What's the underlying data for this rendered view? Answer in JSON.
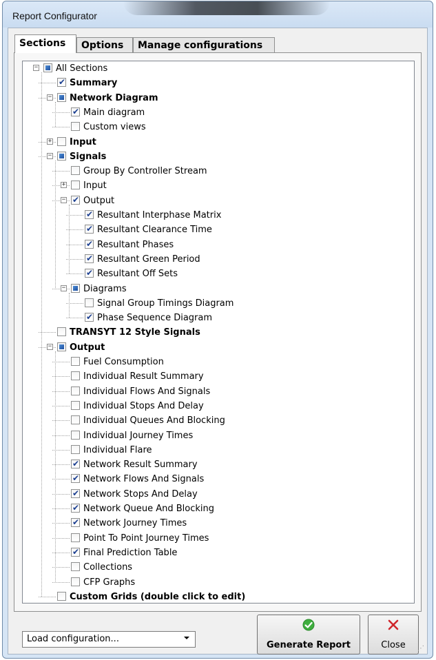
{
  "window": {
    "title": "Report Configurator"
  },
  "tabs": [
    "Sections",
    "Options",
    "Manage configurations"
  ],
  "tree": [
    {
      "label": "All Sections",
      "depth": 0,
      "state": "partial",
      "bold": false,
      "expander": "minus"
    },
    {
      "label": "Summary",
      "depth": 1,
      "state": "checked",
      "bold": true,
      "expander": ""
    },
    {
      "label": "Network Diagram",
      "depth": 1,
      "state": "partial",
      "bold": true,
      "expander": "minus"
    },
    {
      "label": "Main diagram",
      "depth": 2,
      "state": "checked",
      "bold": false,
      "expander": ""
    },
    {
      "label": "Custom views",
      "depth": 2,
      "state": "unchecked",
      "bold": false,
      "expander": ""
    },
    {
      "label": "Input",
      "depth": 1,
      "state": "unchecked",
      "bold": true,
      "expander": "plus"
    },
    {
      "label": "Signals",
      "depth": 1,
      "state": "partial",
      "bold": true,
      "expander": "minus"
    },
    {
      "label": "Group By Controller Stream",
      "depth": 2,
      "state": "unchecked",
      "bold": false,
      "expander": ""
    },
    {
      "label": "Input",
      "depth": 2,
      "state": "unchecked",
      "bold": false,
      "expander": "plus"
    },
    {
      "label": "Output",
      "depth": 2,
      "state": "checked",
      "bold": false,
      "expander": "minus"
    },
    {
      "label": "Resultant Interphase Matrix",
      "depth": 3,
      "state": "checked",
      "bold": false,
      "expander": ""
    },
    {
      "label": "Resultant Clearance Time",
      "depth": 3,
      "state": "checked",
      "bold": false,
      "expander": ""
    },
    {
      "label": "Resultant Phases",
      "depth": 3,
      "state": "checked",
      "bold": false,
      "expander": ""
    },
    {
      "label": "Resultant Green Period",
      "depth": 3,
      "state": "checked",
      "bold": false,
      "expander": ""
    },
    {
      "label": "Resultant Off Sets",
      "depth": 3,
      "state": "checked",
      "bold": false,
      "expander": ""
    },
    {
      "label": "Diagrams",
      "depth": 2,
      "state": "partial",
      "bold": false,
      "expander": "minus"
    },
    {
      "label": "Signal Group Timings Diagram",
      "depth": 3,
      "state": "unchecked",
      "bold": false,
      "expander": ""
    },
    {
      "label": "Phase Sequence Diagram",
      "depth": 3,
      "state": "checked",
      "bold": false,
      "expander": ""
    },
    {
      "label": "TRANSYT 12 Style Signals",
      "depth": 1,
      "state": "unchecked",
      "bold": true,
      "expander": ""
    },
    {
      "label": "Output",
      "depth": 1,
      "state": "partial",
      "bold": true,
      "expander": "minus"
    },
    {
      "label": "Fuel Consumption",
      "depth": 2,
      "state": "unchecked",
      "bold": false,
      "expander": ""
    },
    {
      "label": "Individual Result Summary",
      "depth": 2,
      "state": "unchecked",
      "bold": false,
      "expander": ""
    },
    {
      "label": "Individual Flows And Signals",
      "depth": 2,
      "state": "unchecked",
      "bold": false,
      "expander": ""
    },
    {
      "label": "Individual Stops And Delay",
      "depth": 2,
      "state": "unchecked",
      "bold": false,
      "expander": ""
    },
    {
      "label": "Individual Queues And Blocking",
      "depth": 2,
      "state": "unchecked",
      "bold": false,
      "expander": ""
    },
    {
      "label": "Individual Journey Times",
      "depth": 2,
      "state": "unchecked",
      "bold": false,
      "expander": ""
    },
    {
      "label": "Individual Flare",
      "depth": 2,
      "state": "unchecked",
      "bold": false,
      "expander": ""
    },
    {
      "label": "Network Result Summary",
      "depth": 2,
      "state": "checked",
      "bold": false,
      "expander": ""
    },
    {
      "label": "Network Flows And Signals",
      "depth": 2,
      "state": "checked",
      "bold": false,
      "expander": ""
    },
    {
      "label": "Network Stops And Delay",
      "depth": 2,
      "state": "checked",
      "bold": false,
      "expander": ""
    },
    {
      "label": "Network Queue And Blocking",
      "depth": 2,
      "state": "checked",
      "bold": false,
      "expander": ""
    },
    {
      "label": "Network Journey Times",
      "depth": 2,
      "state": "checked",
      "bold": false,
      "expander": ""
    },
    {
      "label": "Point To Point Journey Times",
      "depth": 2,
      "state": "unchecked",
      "bold": false,
      "expander": ""
    },
    {
      "label": "Final Prediction Table",
      "depth": 2,
      "state": "checked",
      "bold": false,
      "expander": ""
    },
    {
      "label": "Collections",
      "depth": 2,
      "state": "unchecked",
      "bold": false,
      "expander": ""
    },
    {
      "label": "CFP Graphs",
      "depth": 2,
      "state": "unchecked",
      "bold": false,
      "expander": ""
    },
    {
      "label": "Custom Grids (double click to edit)",
      "depth": 1,
      "state": "unchecked",
      "bold": true,
      "expander": ""
    }
  ],
  "bottom": {
    "load_configuration": "Load configuration...",
    "generate_label": "Generate Report",
    "close_label": "Close",
    "generate_icon": "check-circle-icon",
    "close_icon": "red-x-icon"
  },
  "colors": {
    "accent": "#1f4e9c",
    "check": "#1b3f91",
    "close_x": "#d0262b",
    "ok_green": "#3fae3f"
  }
}
